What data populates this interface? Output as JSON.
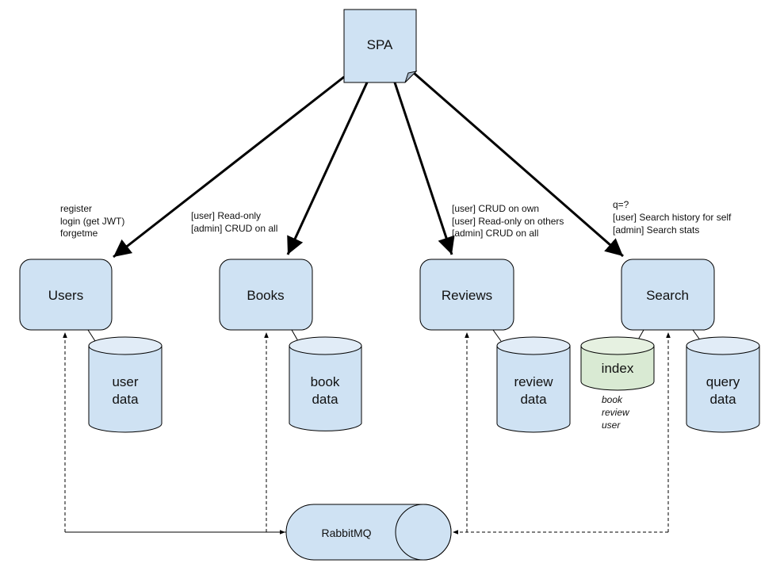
{
  "spa": {
    "label": "SPA"
  },
  "services": [
    {
      "label": "Users",
      "annotation": [
        "register",
        "login (get JWT)",
        "forgetme"
      ],
      "store": [
        "user",
        "data"
      ]
    },
    {
      "label": "Books",
      "annotation": [
        "[user] Read-only",
        "[admin] CRUD on all"
      ],
      "store": [
        "book",
        "data"
      ]
    },
    {
      "label": "Reviews",
      "annotation": [
        "[user] CRUD on own",
        "[user] Read-only on others",
        "[admin] CRUD on all"
      ],
      "store": [
        "review",
        "data"
      ]
    },
    {
      "label": "Search",
      "annotation": [
        "q=?",
        "[user] Search history for self",
        "[admin] Search stats"
      ],
      "store": [
        "query",
        "data"
      ]
    }
  ],
  "index": {
    "label": "index",
    "contents": [
      "book",
      "review",
      "user"
    ]
  },
  "queue": {
    "label": "RabbitMQ"
  },
  "colors": {
    "box_fill": "#cfe2f3",
    "box_top": "#e1ecf7",
    "index_fill": "#d9ead3",
    "index_top": "#e6f1e1",
    "stroke": "#000000"
  }
}
